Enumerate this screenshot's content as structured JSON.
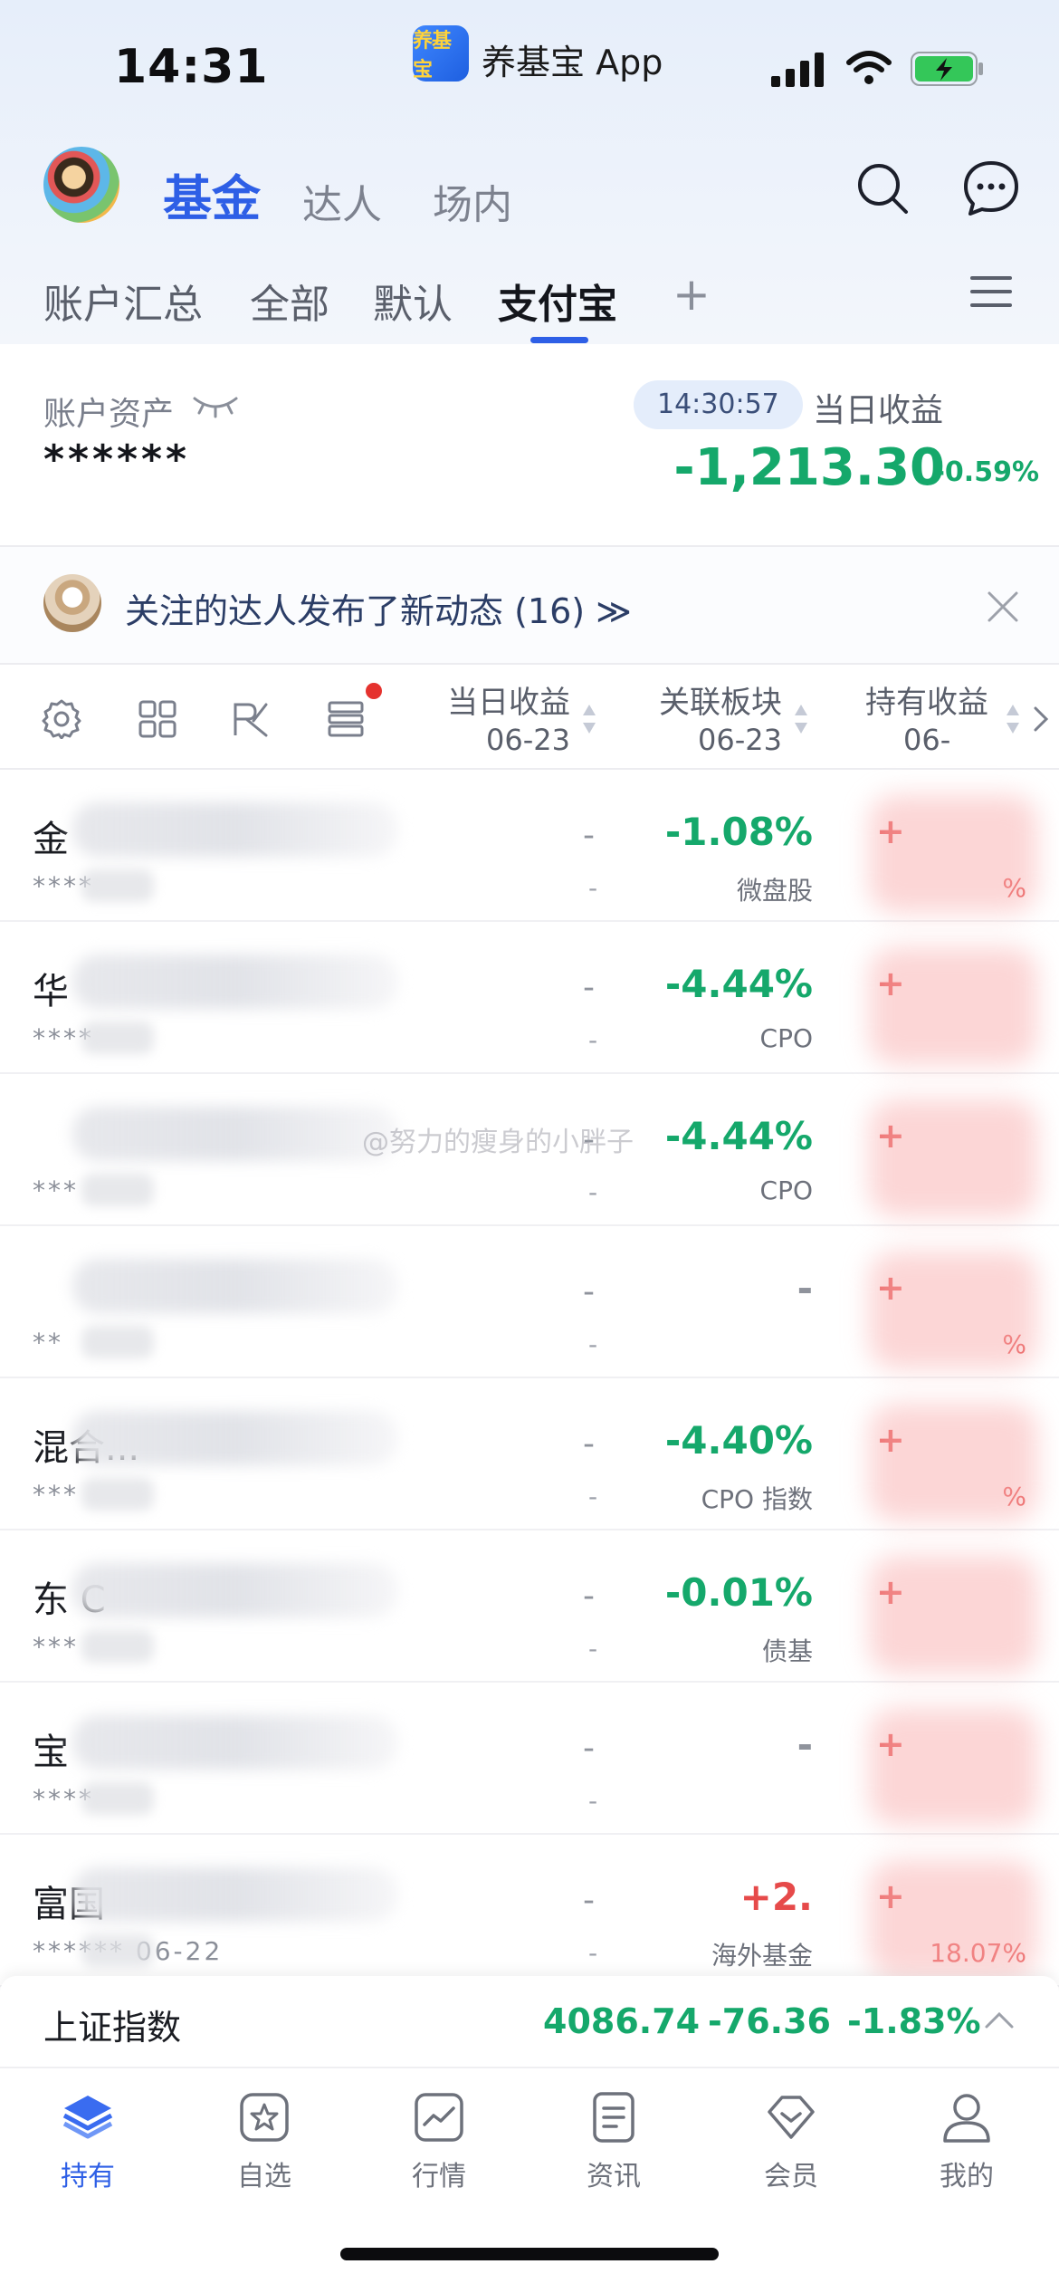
{
  "status_bar": {
    "time": "14:31",
    "app_badge": "养基宝",
    "app_name": "养基宝 App"
  },
  "header": {
    "tabs": [
      "基金",
      "达人",
      "场内"
    ],
    "sub_tabs": [
      "账户汇总",
      "全部",
      "默认",
      "支付宝"
    ],
    "add_tab": "+"
  },
  "asset": {
    "label": "账户资产",
    "value": "******",
    "time": "14:30:57",
    "daily_label": "当日收益",
    "daily_value": "-1,213.30",
    "daily_pct": "-0.59%"
  },
  "notice": {
    "text": "关注的达人发布了新动态 (16) ≫"
  },
  "columns": {
    "daily": {
      "title": "当日收益",
      "date": "06-23"
    },
    "sector": {
      "title": "关联板块",
      "date": "06-23"
    },
    "hold": {
      "title": "持有收益",
      "date": "06-"
    }
  },
  "funds": [
    {
      "name": "金",
      "code": "****",
      "daily": "-",
      "daily_sub": "-",
      "sector_pct": "-1.08%",
      "sector_name": "微盘股",
      "sector_color": "#15a86b",
      "hold": "+",
      "hold_pct": "%"
    },
    {
      "name": "华",
      "code": "****",
      "daily": "-",
      "daily_sub": "-",
      "sector_pct": "-4.44%",
      "sector_name": "CPO",
      "sector_color": "#15a86b",
      "hold": "+",
      "hold_pct": ""
    },
    {
      "name": "",
      "code": "***",
      "daily": "-",
      "daily_sub": "-",
      "sector_pct": "-4.44%",
      "sector_name": "CPO",
      "sector_color": "#15a86b",
      "hold": "+",
      "hold_pct": ""
    },
    {
      "name": "",
      "code": "**",
      "daily": "-",
      "daily_sub": "-",
      "sector_pct": "-",
      "sector_name": "",
      "sector_color": "#8f939c",
      "hold": "+",
      "hold_pct": "%"
    },
    {
      "name": "混合...",
      "code": "***",
      "daily": "-",
      "daily_sub": "-",
      "sector_pct": "-4.40%",
      "sector_name": "CPO 指数",
      "sector_color": "#15a86b",
      "hold": "+",
      "hold_pct": "%"
    },
    {
      "name": "东 C",
      "code": "***",
      "daily": "-",
      "daily_sub": "-",
      "sector_pct": "-0.01%",
      "sector_name": "债基",
      "sector_color": "#15a86b",
      "hold": "+",
      "hold_pct": ""
    },
    {
      "name": "宝",
      "code": "****",
      "daily": "-",
      "daily_sub": "-",
      "sector_pct": "-",
      "sector_name": "",
      "sector_color": "#8f939c",
      "hold": "+",
      "hold_pct": ""
    },
    {
      "name": "富国",
      "code": "****** 06-22",
      "daily": "-",
      "daily_sub": "-",
      "sector_pct": "+2.",
      "sector_name": "海外基金",
      "sector_color": "#e64a4a",
      "hold": "+",
      "hold_pct": "18.07%"
    }
  ],
  "watermark": "@努力的瘦身的小胖子",
  "index": {
    "name": "上证指数",
    "value": "4086.74",
    "change": "-76.36",
    "pct": "-1.83%"
  },
  "nav": [
    {
      "label": "持有",
      "icon": "layers-icon"
    },
    {
      "label": "自选",
      "icon": "star-icon"
    },
    {
      "label": "行情",
      "icon": "chart-icon"
    },
    {
      "label": "资讯",
      "icon": "news-icon"
    },
    {
      "label": "会员",
      "icon": "diamond-icon"
    },
    {
      "label": "我的",
      "icon": "person-icon"
    }
  ],
  "colors": {
    "accent": "#2e5fe6",
    "down": "#15a86b",
    "up": "#e64a4a"
  }
}
